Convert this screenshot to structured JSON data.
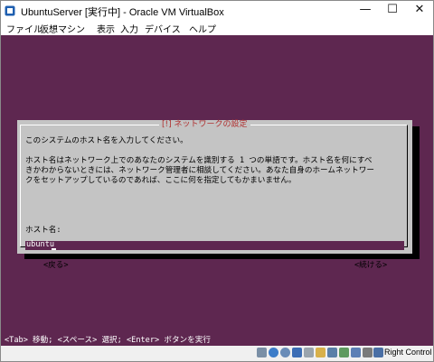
{
  "window": {
    "title": "UbuntuServer [実行中] - Oracle VM VirtualBox",
    "controls": {
      "minimize": "—",
      "maximize": "☐",
      "close": "✕"
    }
  },
  "menu": [
    "ファイル",
    "仮想マシン",
    "表示",
    "入力",
    "デバイス",
    "ヘルプ"
  ],
  "dialog": {
    "title": "[!] ネットワークの設定",
    "body": "このシステムのホスト名を入力してください。\n\nホスト名はネットワーク上でのあなたのシステムを識別する 1 つの単語です。ホスト名を何にすべ\nきかわからないときには、ネットワーク管理者に相談してください。あなた自身のホームネットワー\nクをセットアップしているのであれば、ここに何を指定してもかまいません。",
    "field_label": "ホスト名:",
    "field_value": "ubuntu",
    "back_button": "<戻る>",
    "next_button": "<続ける>"
  },
  "help_line": "<Tab> 移動; <スペース> 選択; <Enter> ボタンを実行",
  "statusbar": {
    "host_key": "Right Control",
    "icons": [
      "hdd-icon",
      "optical-drive-icon",
      "audio-icon",
      "network-icon",
      "usb-icon",
      "shared-folder-icon",
      "display-icon",
      "video-capture-icon",
      "cpu-icon",
      "mouse-integration-icon",
      "keyboard-icon"
    ]
  },
  "colors": {
    "console_bg": "#5e2750",
    "dialog_bg": "#c4c4c4",
    "dialog_title": "#b03030"
  }
}
